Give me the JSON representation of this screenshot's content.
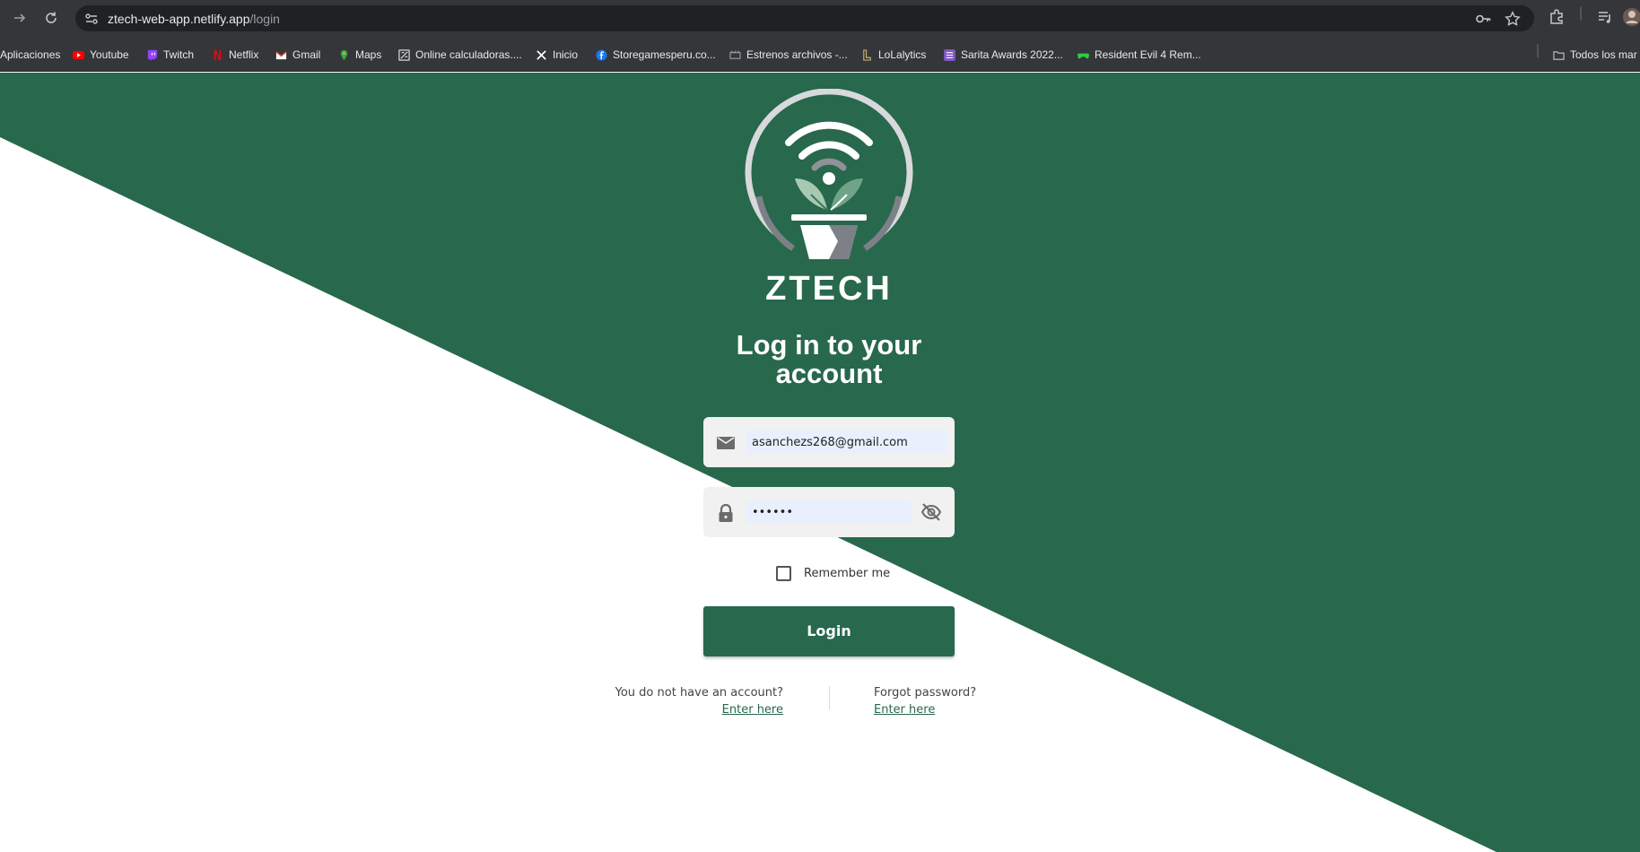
{
  "browser": {
    "url_host": "ztech-web-app.netlify.app",
    "url_path": "/login",
    "bookmarks": [
      {
        "label": "Aplicaciones",
        "icon": "apps-grid-icon",
        "color": "#8ab4f8"
      },
      {
        "label": "Youtube",
        "icon": "youtube-icon",
        "color": "#ff0000"
      },
      {
        "label": "Twitch",
        "icon": "twitch-icon",
        "color": "#9146ff"
      },
      {
        "label": "Netflix",
        "icon": "netflix-icon",
        "color": "#e50914"
      },
      {
        "label": "Gmail",
        "icon": "gmail-icon",
        "color": "#ea4335"
      },
      {
        "label": "Maps",
        "icon": "maps-pin-icon",
        "color": "#34a853"
      },
      {
        "label": "Online calculadoras....",
        "icon": "calculator-icon",
        "color": "#e8eaed"
      },
      {
        "label": "Inicio",
        "icon": "x-logo-icon",
        "color": "#ffffff"
      },
      {
        "label": "Storegamesperu.co...",
        "icon": "facebook-icon",
        "color": "#1877f2"
      },
      {
        "label": "Estrenos archivos -...",
        "icon": "film-icon",
        "color": "#9aa0a6"
      },
      {
        "label": "LoLalytics",
        "icon": "lolalytics-icon",
        "color": "#c8aa6e"
      },
      {
        "label": "Sarita Awards 2022...",
        "icon": "list-icon",
        "color": "#7e57c2"
      },
      {
        "label": "Resident Evil 4 Rem...",
        "icon": "gamepad-icon",
        "color": "#2ecc40"
      }
    ],
    "all_bookmarks_label": "Todos los mar"
  },
  "page": {
    "brand": "ZTECH",
    "title": "Log in to your account",
    "email_value": "asanchezs268@gmail.com",
    "password_value": "••••••",
    "remember_label": "Remember me",
    "login_label": "Login",
    "no_account_text": "You do not have an account?",
    "no_account_link": "Enter here",
    "forgot_text": "Forgot password?",
    "forgot_link": "Enter here"
  },
  "colors": {
    "brand_green": "#28684c",
    "chrome_dark": "#35363a",
    "omnibox": "#202124"
  }
}
